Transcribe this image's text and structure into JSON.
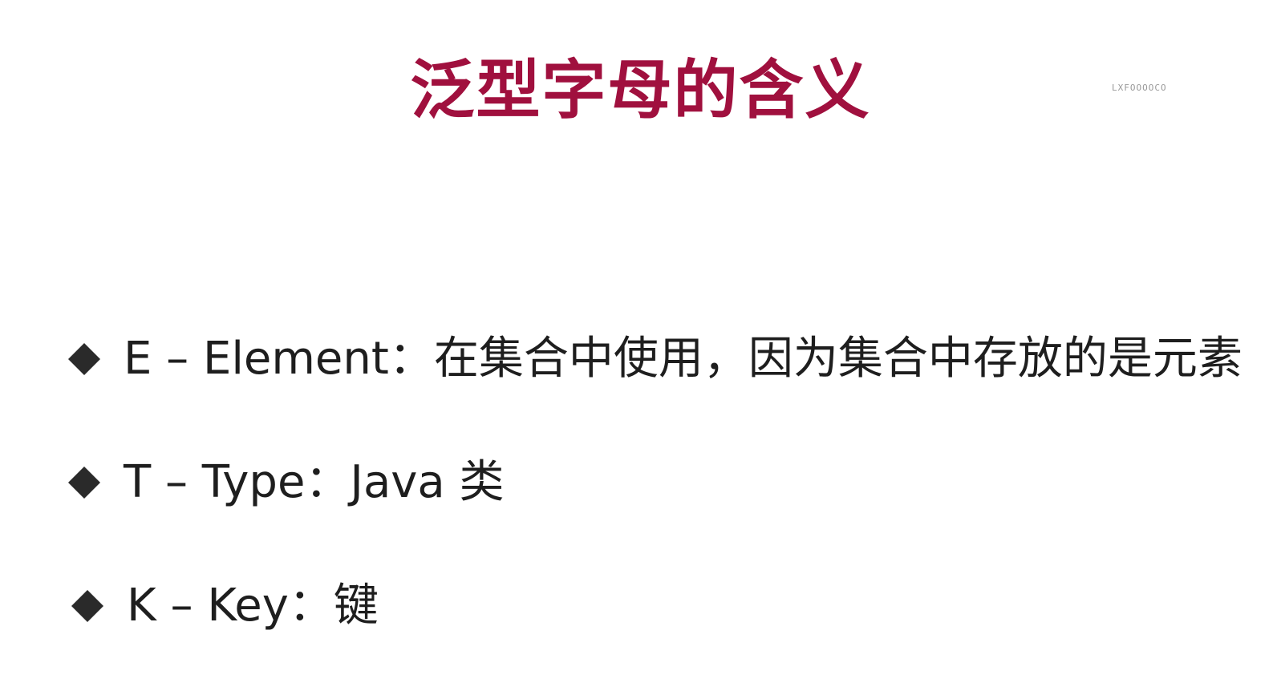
{
  "slide": {
    "title": "泛型字母的含义",
    "watermark": "LXFOOOOCO",
    "bullets": [
      {
        "text": "E – Element：在集合中使用，因为集合中存放的是元素",
        "icon": "diamond-bullet-icon"
      },
      {
        "text": "T – Type：Java 类",
        "icon": "diamond-bullet-icon"
      },
      {
        "text": "K – Key：键",
        "icon": "diamond-bullet-icon"
      }
    ]
  },
  "colors": {
    "title": "#a0103e",
    "body_text": "#1e1e1e",
    "bullet": "#2a2a2a",
    "background": "#ffffff"
  }
}
